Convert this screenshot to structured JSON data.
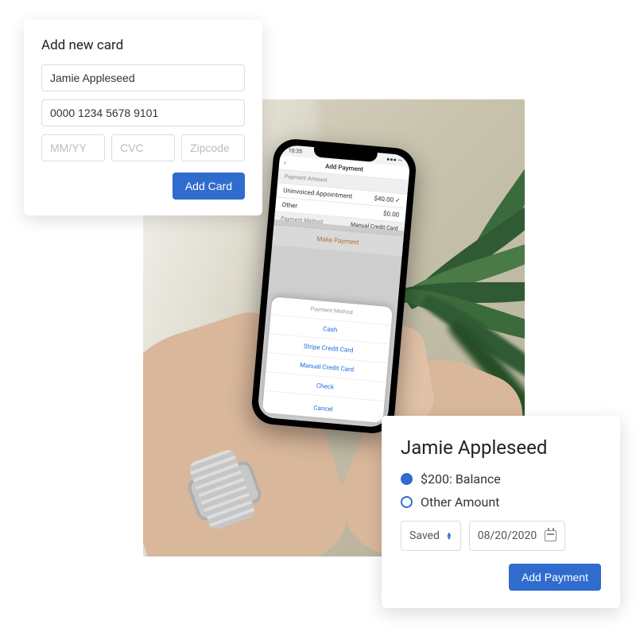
{
  "card_form": {
    "title": "Add new card",
    "name_value": "Jamie Appleseed",
    "number_value": "0000 1234 5678 9101",
    "expiry_placeholder": "MM/YY",
    "cvc_placeholder": "CVC",
    "zip_placeholder": "Zipcode",
    "submit_label": "Add Card"
  },
  "payment_panel": {
    "customer_name": "Jamie Appleseed",
    "balance_label": "$200: Balance",
    "other_label": "Other Amount",
    "saved_method_label": "Saved",
    "date_value": "08/20/2020",
    "submit_label": "Add Payment"
  },
  "phone": {
    "time": "10:35",
    "title": "Add Payment",
    "section_amount": "Payment Amount",
    "row_uninvoiced": "Uninvoiced Appointment",
    "row_uninvoiced_val": "$40.00 ✓",
    "row_other": "Other",
    "row_other_val": "$0.00",
    "section_method": "Payment Method",
    "method_value": "Manual Credit Card",
    "make_payment": "Make Payment",
    "sheet_title": "Payment Method",
    "opt_cash": "Cash",
    "opt_stripe": "Stripe Credit Card",
    "opt_manual": "Manual Credit Card",
    "opt_check": "Check",
    "cancel": "Cancel"
  }
}
